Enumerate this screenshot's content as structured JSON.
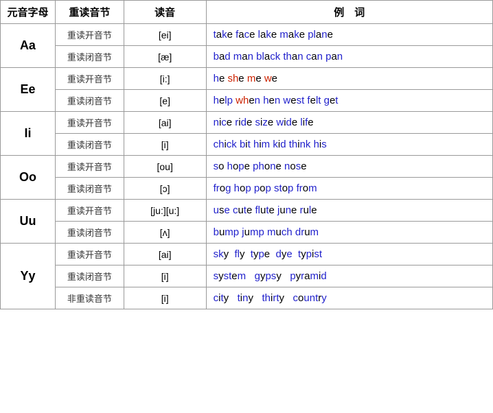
{
  "header": {
    "col1": "元音字母",
    "col2": "重读音节",
    "col3": "读音",
    "col4": "例　词"
  },
  "rows": [
    {
      "letter": "Aa",
      "sub": [
        {
          "syllable": "重读开音节",
          "pron": "[ei]",
          "example_html": "<span class='blue'>t</span>a<span class='blue'>k</span>e <span class='blue'>f</span>a<span class='blue'>c</span>e <span class='blue'>l</span>a<span class='blue'>k</span>e <span class='blue'>m</span>a<span class='blue'>k</span>e <span class='blue'>pl</span>a<span class='blue'>n</span>e"
        },
        {
          "syllable": "重读闭音节",
          "pron": "[æ]",
          "example_html": "<span class='blue'>b</span>a<span class='blue'>d</span> <span class='blue'>m</span>a<span class='blue'>n</span> <span class='blue'>bl</span>a<span class='blue'>ck</span> <span class='blue'>th</span>a<span class='blue'>n</span> <span class='blue'>c</span>a<span class='blue'>n</span> <span class='blue'>p</span>a<span class='blue'>n</span>"
        }
      ]
    },
    {
      "letter": "Ee",
      "sub": [
        {
          "syllable": "重读开音节",
          "pron": "[i:]",
          "example_html": "<span class='blue'>h</span>e <span class='red'>sh</span>e <span class='red'>m</span>e <span class='red'>w</span>e"
        },
        {
          "syllable": "重读闭音节",
          "pron": "[e]",
          "example_html": "<span class='blue'>h</span>e<span class='blue'>lp</span> <span class='red'>wh</span>e<span class='blue'>n</span> <span class='blue'>h</span>e<span class='blue'>n</span> <span class='blue'>w</span>e<span class='blue'>st</span> <span class='blue'>f</span>e<span class='blue'>lt</span> <span class='blue'>g</span>e<span class='blue'>t</span>"
        }
      ]
    },
    {
      "letter": "Ii",
      "sub": [
        {
          "syllable": "重读开音节",
          "pron": "[ai]",
          "example_html": "<span class='blue'>n</span>i<span class='blue'>c</span>e <span class='blue'>r</span>i<span class='blue'>d</span>e <span class='blue'>s</span>i<span class='blue'>z</span>e <span class='blue'>w</span>i<span class='blue'>d</span>e <span class='blue'>l</span>i<span class='blue'>f</span>e"
        },
        {
          "syllable": "重读闭音节",
          "pron": "[i]",
          "example_html": "<span class='blue'>ch</span>i<span class='blue'>ck</span> <span class='blue'>b</span>i<span class='blue'>t</span> <span class='blue'>h</span>i<span class='blue'>m</span> <span class='blue'>k</span>i<span class='blue'>d</span> <span class='blue'>th</span>i<span class='blue'>nk</span> <span class='blue'>h</span>i<span class='blue'>s</span>"
        }
      ]
    },
    {
      "letter": "Oo",
      "sub": [
        {
          "syllable": "重读开音节",
          "pron": "[ou]",
          "example_html": "<span class='blue'>s</span>o <span class='blue'>h</span>o<span class='blue'>p</span>e <span class='blue'>ph</span>o<span class='blue'>n</span>e <span class='blue'>n</span>o<span class='blue'>s</span>e"
        },
        {
          "syllable": "重读闭音节",
          "pron": "[ɔ]",
          "example_html": "<span class='blue'>fr</span>o<span class='blue'>g</span> <span class='blue'>h</span>o<span class='blue'>p</span> <span class='blue'>p</span>o<span class='blue'>p</span> <span class='blue'>st</span>o<span class='blue'>p</span> <span class='blue'>fr</span>o<span class='blue'>m</span>"
        }
      ]
    },
    {
      "letter": "Uu",
      "sub": [
        {
          "syllable": "重读开音节",
          "pron": "[ju:][u:]",
          "example_html": "<span class='blue'>u</span>s<span class='blue'>e</span> <span class='blue'>c</span>u<span class='blue'>t</span>e <span class='blue'>fl</span>u<span class='blue'>t</span>e <span class='blue'>j</span>u<span class='blue'>n</span>e <span class='blue'>r</span>u<span class='blue'>l</span>e"
        },
        {
          "syllable": "重读闭音节",
          "pron": "[ʌ]",
          "example_html": "<span class='blue'>b</span>u<span class='blue'>mp</span> <span class='blue'>j</span>u<span class='blue'>mp</span> <span class='blue'>m</span>u<span class='blue'>ch</span> <span class='blue'>dr</span>u<span class='blue'>m</span>"
        }
      ]
    },
    {
      "letter": "Yy",
      "sub": [
        {
          "syllable": "重读开音节",
          "pron": "[ai]",
          "example_html": "<span class='blue'>sk</span>y &nbsp;<span class='blue'>fl</span>y &nbsp;<span class='blue'>t</span>y<span class='blue'>p</span>e &nbsp;<span class='blue'>d</span>y<span class='blue'>e</span> &nbsp;<span class='blue'>t</span>y<span class='blue'>p</span>i<span class='blue'>st</span>"
        },
        {
          "syllable": "重读闭音节",
          "pron": "[i]",
          "example_html": "<span class='blue'>s</span>y<span class='blue'>st</span>e<span class='blue'>m</span> &nbsp;&nbsp;<span class='blue'>g</span>y<span class='blue'>ps</span>y &nbsp;&nbsp;<span class='blue'>p</span>y<span class='blue'>r</span>a<span class='blue'>m</span>i<span class='blue'>d</span>"
        },
        {
          "syllable": "非重读音节",
          "pron": "[i]",
          "example_html": "<span class='blue'>c</span>i<span class='blue'>t</span>y &nbsp;&nbsp;<span class='blue'>t</span>i<span class='blue'>n</span>y &nbsp;&nbsp;<span class='blue'>th</span>i<span class='blue'>rt</span>y &nbsp;&nbsp;<span class='blue'>c</span>o<span class='blue'>unt</span>r<span class='blue'>y</span>"
        }
      ]
    }
  ]
}
